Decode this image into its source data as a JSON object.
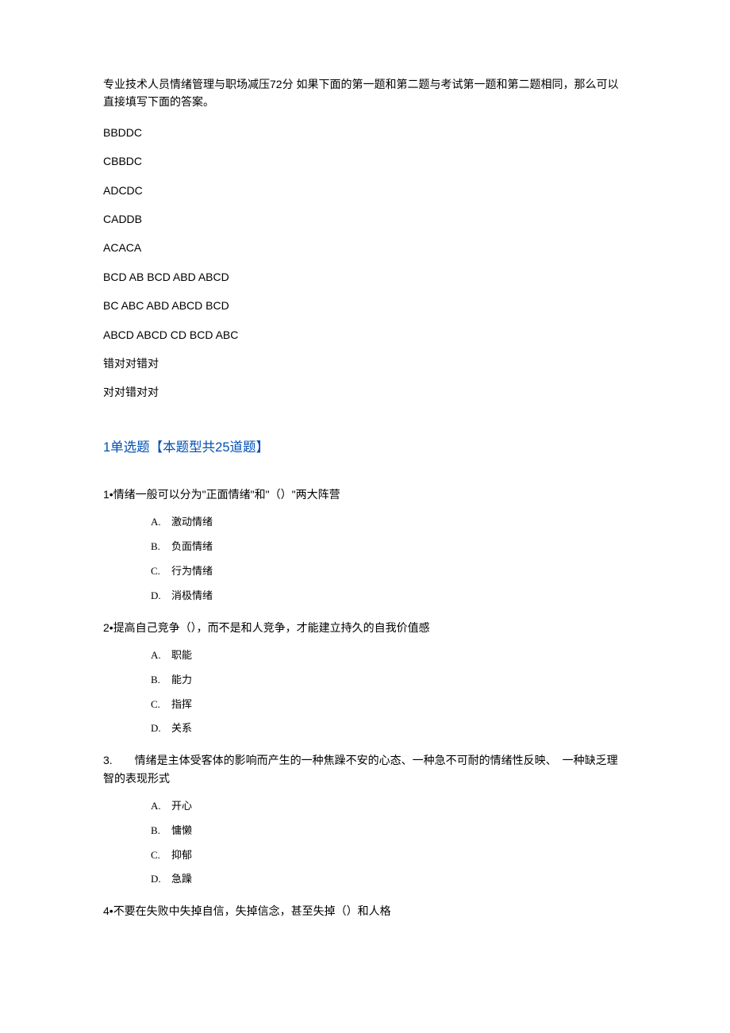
{
  "intro": "专业技术人员情绪管理与职场减压72分  如果下面的第一题和第二题与考试第一题和第二题相同，那么可以直接填写下面的答案。",
  "answerLines": [
    "BBDDC",
    "CBBDC",
    "ADCDC",
    "CADDB",
    "ACACA",
    "BCD AB BCD ABD ABCD",
    "BC ABC ABD ABCD BCD",
    "ABCD ABCD CD BCD ABC",
    "错对对错对",
    "对对错对对"
  ],
  "sectionHeading": "1单选题【本题型共25道题】",
  "questions": [
    {
      "text": "1•情绪一般可以分为\"正面情绪\"和\"（）\"两大阵营",
      "options": [
        {
          "letter": "A.",
          "label": "激动情绪"
        },
        {
          "letter": "B.",
          "label": "负面情绪"
        },
        {
          "letter": "C.",
          "label": "行为情绪"
        },
        {
          "letter": "D.",
          "label": "消极情绪"
        }
      ]
    },
    {
      "text": "2•提高自己竞争（），而不是和人竞争，才能建立持久的自我价值感",
      "options": [
        {
          "letter": "A.",
          "label": "职能"
        },
        {
          "letter": "B.",
          "label": "能力"
        },
        {
          "letter": "C.",
          "label": "指挥"
        },
        {
          "letter": "D.",
          "label": "关系"
        }
      ]
    },
    {
      "text": "3.　　情绪是主体受客体的影响而产生的一种焦躁不安的心态、一种急不可耐的情绪性反映、　一种缺乏理智的表现形式",
      "options": [
        {
          "letter": "A.",
          "label": "开心"
        },
        {
          "letter": "B.",
          "label": "慵懒"
        },
        {
          "letter": "C.",
          "label": "抑郁"
        },
        {
          "letter": "D.",
          "label": "急躁"
        }
      ]
    },
    {
      "text": "4•不要在失败中失掉自信，失掉信念，甚至失掉（）和人格",
      "options": []
    }
  ]
}
